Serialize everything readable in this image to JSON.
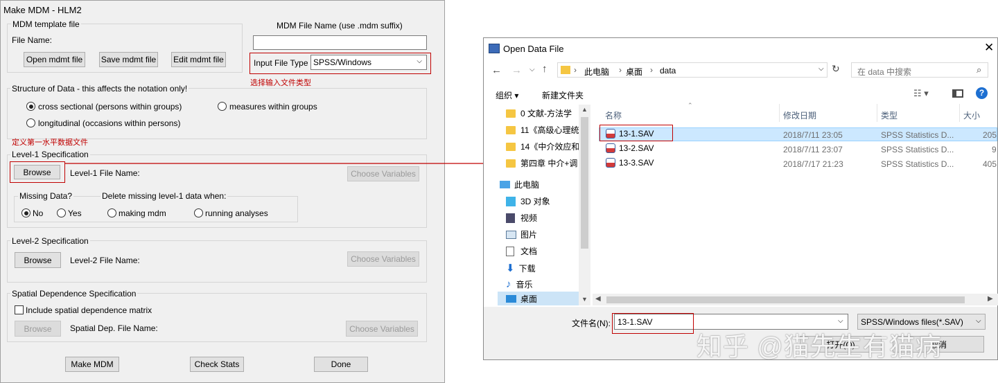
{
  "mdm": {
    "title": "Make MDM - HLM2",
    "template_group": "MDM template file",
    "file_name_label": "File Name:",
    "open_btn": "Open mdmt file",
    "save_btn": "Save mdmt file",
    "edit_btn": "Edit mdmt file",
    "mdm_file_label": "MDM File Name (use .mdm suffix)",
    "mdm_file_value": "",
    "input_type_label": "Input File Type",
    "input_type_value": "SPSS/Windows",
    "anno_input_type": "选择输入文件类型",
    "structure_group": "Structure of Data - this affects the notation only!",
    "opt_cross": "cross sectional (persons within groups)",
    "opt_measures": "measures within groups",
    "opt_long": "longitudinal (occasions within persons)",
    "anno_level1": "定义第一水平数据文件",
    "level1_group": "Level-1 Specification",
    "browse": "Browse",
    "level1_file_label": "Level-1 File Name:",
    "choose_vars": "Choose Variables",
    "missing_label": "Missing Data?",
    "delete_label": "Delete missing level-1 data when:",
    "no": "No",
    "yes": "Yes",
    "making_mdm": "making mdm",
    "running_analyses": "running analyses",
    "level2_group": "Level-2 Specification",
    "level2_file_label": "Level-2 File Name:",
    "spatial_group": "Spatial Dependence Specification",
    "include_spatial": "Include spatial dependence matrix",
    "spatial_file_label": "Spatial Dep. File Name:",
    "make_mdm": "Make MDM",
    "check_stats": "Check Stats",
    "done": "Done"
  },
  "open": {
    "title": "Open Data File",
    "crumbs": [
      "此电脑",
      "桌面",
      "data"
    ],
    "search_placeholder": "在 data 中搜索",
    "organize": "组织 ▾",
    "new_folder": "新建文件夹",
    "nav": [
      "0 文献-方法学",
      "11《高级心理统",
      "14《中介效应和",
      "第四章 中介+调",
      "此电脑",
      "3D 对象",
      "视频",
      "图片",
      "文档",
      "下载",
      "音乐",
      "桌面"
    ],
    "columns": [
      "名称",
      "修改日期",
      "类型",
      "大小"
    ],
    "files": [
      {
        "name": "13-1.SAV",
        "date": "2018/7/11 23:05",
        "type": "SPSS Statistics D...",
        "size": "205"
      },
      {
        "name": "13-2.SAV",
        "date": "2018/7/11 23:07",
        "type": "SPSS Statistics D...",
        "size": "9"
      },
      {
        "name": "13-3.SAV",
        "date": "2018/7/17 21:23",
        "type": "SPSS Statistics D...",
        "size": "405"
      }
    ],
    "filename_label": "文件名(N):",
    "filename_value": "13-1.SAV",
    "filter_value": "SPSS/Windows files(*.SAV)",
    "open_btn": "打开(O)",
    "cancel_btn": "取消"
  },
  "watermark": "知乎 @猫先生有猫病"
}
